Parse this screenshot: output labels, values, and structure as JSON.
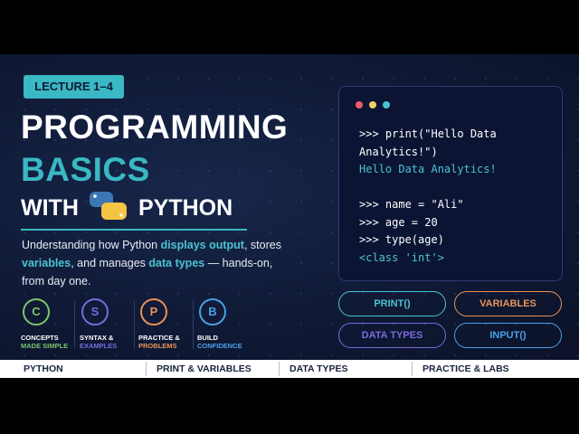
{
  "badge": "LECTURE 1–4",
  "title": {
    "line1": "PROGRAMMING",
    "line2": "BASICS",
    "with": "WITH",
    "python": "PYTHON"
  },
  "description": {
    "p1": "Understanding how Python ",
    "h1": "displays output",
    "p2": ", stores ",
    "h2": "variables",
    "p3": ", and manages ",
    "h3": "data types",
    "p4": " — hands-on, from day one."
  },
  "features": [
    {
      "letter": "C",
      "line1": "CONCEPTS",
      "line2": "MADE SIMPLE",
      "color": "#7cc46a"
    },
    {
      "letter": "S",
      "line1": "SYNTAX &",
      "line2": "EXAMPLES",
      "color": "#7a6ae0"
    },
    {
      "letter": "P",
      "line1": "PRACTICE &",
      "line2": "PROBLEMS",
      "color": "#e8925a"
    },
    {
      "letter": "B",
      "line1": "BUILD",
      "line2": "CONFIDENCE",
      "color": "#4aa0e8"
    }
  ],
  "terminal": {
    "dots": [
      "#ef5b6b",
      "#f0d060",
      "#4cc3d0"
    ],
    "lines": [
      {
        "text": ">>> print(\"Hello Data",
        "type": "input"
      },
      {
        "text": "Analytics!\")",
        "type": "input"
      },
      {
        "text": "Hello Data Analytics!",
        "type": "output"
      },
      {
        "text": "",
        "type": "blank"
      },
      {
        "text": ">>> name = \"Ali\"",
        "type": "input"
      },
      {
        "text": ">>> age = 20",
        "type": "input"
      },
      {
        "text": ">>> type(age)",
        "type": "input"
      },
      {
        "text": "<class 'int'>",
        "type": "output"
      }
    ]
  },
  "pills": [
    {
      "label": "PRINT()",
      "color": "#4cc3d0"
    },
    {
      "label": "VARIABLES",
      "color": "#e8925a"
    },
    {
      "label": "DATA TYPES",
      "color": "#7a6ae0"
    },
    {
      "label": "INPUT()",
      "color": "#4aa0e8"
    }
  ],
  "footer": [
    "PYTHON",
    "PRINT & VARIABLES",
    "DATA TYPES",
    "PRACTICE & LABS"
  ]
}
